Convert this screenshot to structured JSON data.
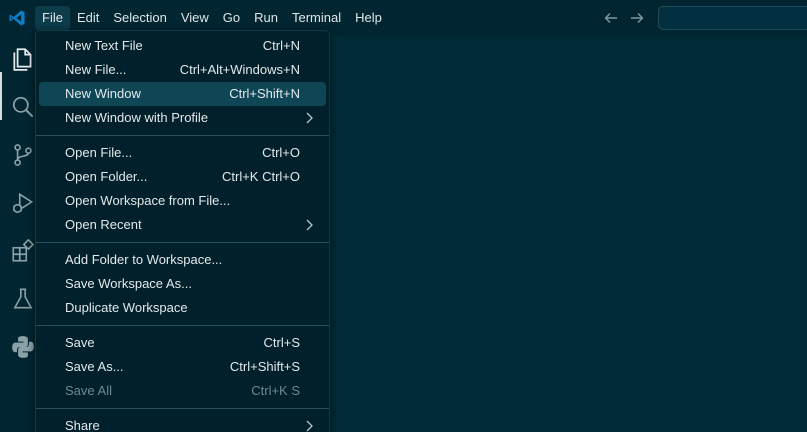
{
  "menubar": {
    "items": [
      "File",
      "Edit",
      "Selection",
      "View",
      "Go",
      "Run",
      "Terminal",
      "Help"
    ]
  },
  "colors": {
    "accent": "#0c7fc9",
    "background": "#012631",
    "menu_background": "#00212b",
    "highlight": "#0f4656"
  },
  "activitybar": {
    "icons": [
      "explorer-icon",
      "search-icon",
      "source-control-icon",
      "run-debug-icon",
      "extensions-icon",
      "testing-icon",
      "python-icon"
    ]
  },
  "file_menu": {
    "groups": [
      [
        {
          "label": "New Text File",
          "shortcut": "Ctrl+N"
        },
        {
          "label": "New File...",
          "shortcut": "Ctrl+Alt+Windows+N"
        },
        {
          "label": "New Window",
          "shortcut": "Ctrl+Shift+N",
          "highlighted": true
        },
        {
          "label": "New Window with Profile",
          "submenu": true
        }
      ],
      [
        {
          "label": "Open File...",
          "shortcut": "Ctrl+O"
        },
        {
          "label": "Open Folder...",
          "shortcut": "Ctrl+K Ctrl+O"
        },
        {
          "label": "Open Workspace from File...",
          "shortcut": ""
        },
        {
          "label": "Open Recent",
          "submenu": true
        }
      ],
      [
        {
          "label": "Add Folder to Workspace...",
          "shortcut": ""
        },
        {
          "label": "Save Workspace As...",
          "shortcut": ""
        },
        {
          "label": "Duplicate Workspace",
          "shortcut": ""
        }
      ],
      [
        {
          "label": "Save",
          "shortcut": "Ctrl+S"
        },
        {
          "label": "Save As...",
          "shortcut": "Ctrl+Shift+S"
        },
        {
          "label": "Save All",
          "shortcut": "Ctrl+K S",
          "disabled": true
        }
      ],
      [
        {
          "label": "Share",
          "submenu": true
        }
      ]
    ]
  }
}
